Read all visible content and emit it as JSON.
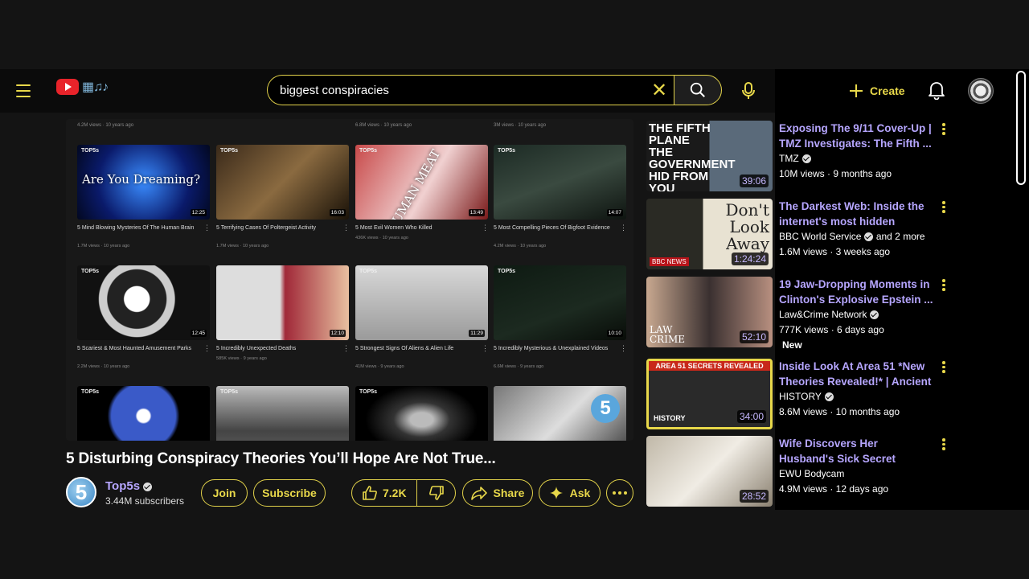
{
  "header": {
    "search_query": "biggest conspiracies",
    "create_label": "Create"
  },
  "player_grid": {
    "row0_meta": [
      "4.2M views · 10 years ago",
      "6.8M views · 10 years ago",
      "3M views · 10 years ago"
    ],
    "items": [
      {
        "badge": "TOP5s",
        "thumb_text": "Are You Dreaming?",
        "duration": "12:25",
        "title": "5 Mind Blowing Mysteries Of The Human Brain",
        "meta": "1.7M views · 10 years ago"
      },
      {
        "badge": "TOP5s",
        "thumb_text": "",
        "duration": "16:03",
        "title": "5 Terrifying Cases Of Poltergeist Activity",
        "meta": "1.7M views · 10 years ago"
      },
      {
        "badge": "TOP5s",
        "thumb_text": "HUMAN MEAT",
        "duration": "13:49",
        "title": "5 Most Evil Women Who Killed",
        "meta": "436K views · 10 years ago"
      },
      {
        "badge": "TOP5s",
        "thumb_text": "",
        "duration": "14:07",
        "title": "5 Most Compelling Pieces Of Bigfoot Evidence",
        "meta": "4.2M views · 10 years ago"
      },
      {
        "badge": "TOP5s",
        "thumb_text": "",
        "duration": "12:45",
        "title": "5 Scariest & Most Haunted Amusement Parks",
        "meta": "2.2M views · 10 years ago"
      },
      {
        "badge": "",
        "thumb_text": "",
        "duration": "12:10",
        "title": "5 Incredibly Unexpected Deaths",
        "meta": "585K views · 9 years ago"
      },
      {
        "badge": "TOP5s",
        "thumb_text": "",
        "duration": "11:29",
        "title": "5 Strongest Signs Of Aliens & Alien Life",
        "meta": "41M views · 9 years ago"
      },
      {
        "badge": "TOP5s",
        "thumb_text": "",
        "duration": "10:10",
        "title": "5 Incredibly Mysterious & Unexplained Videos",
        "meta": "6.6M views · 9 years ago"
      },
      {
        "badge": "TOP5s",
        "thumb_text": "",
        "duration": "",
        "title": "",
        "meta": ""
      },
      {
        "badge": "TOP5s",
        "thumb_text": "",
        "duration": "",
        "title": "",
        "meta": ""
      },
      {
        "badge": "TOP5s",
        "thumb_text": "",
        "duration": "",
        "title": "",
        "meta": ""
      },
      {
        "badge": "",
        "thumb_text": "5",
        "duration": "",
        "title": "",
        "meta": ""
      }
    ]
  },
  "video": {
    "title": "5 Disturbing Conspiracy Theories You’ll Hope Are Not True...",
    "channel_name": "Top5s",
    "channel_avatar_text": "5",
    "subscribers": "3.44M subscribers",
    "join_label": "Join",
    "subscribe_label": "Subscribe",
    "likes": "7.2K",
    "share_label": "Share",
    "ask_label": "Ask"
  },
  "recommendations": [
    {
      "thumb_text": "THE FIFTH PLANE THE GOVERNMENT HID FROM YOU",
      "duration": "39:06",
      "title": "Exposing The 9/11 Cover-Up | TMZ Investigates: The Fifth ...",
      "channel": "TMZ",
      "verified": true,
      "channel_extra": "",
      "meta": "10M views · 9 months ago",
      "badge": ""
    },
    {
      "thumb_text": "Don't Look Away",
      "thumb_sub": "BBC NEWS",
      "duration": "1:24:24",
      "title": "The Darkest Web: Inside the internet's most hidden corners...",
      "channel": "BBC World Service",
      "verified": true,
      "channel_extra": "and 2 more",
      "meta": "1.6M views · 3 weeks ago",
      "badge": ""
    },
    {
      "thumb_text": "LAW CRIME",
      "duration": "52:10",
      "title": "19 Jaw-Dropping Moments in Clinton's Explosive Epstein ...",
      "channel": "Law&Crime Network",
      "verified": true,
      "channel_extra": "",
      "meta": "777K views · 6 days ago",
      "badge": "New"
    },
    {
      "thumb_text": "AREA 51 SECRETS REVEALED",
      "thumb_sub": "HISTORY",
      "duration": "34:00",
      "title": "Inside Look At Area 51 *New Theories Revealed!* | Ancient ...",
      "channel": "HISTORY",
      "verified": true,
      "channel_extra": "",
      "meta": "8.6M views · 10 months ago",
      "badge": ""
    },
    {
      "thumb_text": "",
      "duration": "28:52",
      "title": "Wife Discovers Her Husband's Sick Secret",
      "channel": "EWU Bodycam",
      "verified": false,
      "channel_extra": "",
      "meta": "4.9M views · 12 days ago",
      "badge": ""
    }
  ],
  "colors": {
    "accent": "#e8d84a",
    "link": "#b6a6ff",
    "background": "#141414"
  }
}
